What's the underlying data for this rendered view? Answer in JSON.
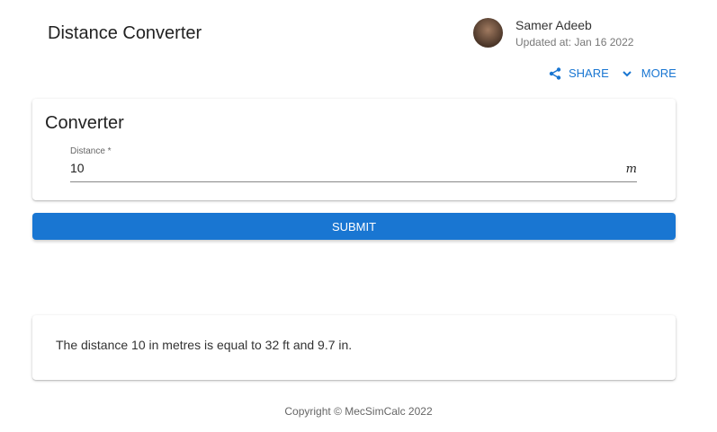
{
  "header": {
    "title": "Distance Converter",
    "author": "Samer Adeeb",
    "updated": "Updated at: Jan 16 2022",
    "share_label": "SHARE",
    "more_label": "MORE"
  },
  "converter": {
    "title": "Converter",
    "field_label": "Distance *",
    "field_value": "10",
    "unit": "m"
  },
  "submit_label": "SUBMIT",
  "result": "The distance 10 in metres is equal to 32 ft and 9.7 in.",
  "footer": "Copyright © MecSimCalc 2022"
}
